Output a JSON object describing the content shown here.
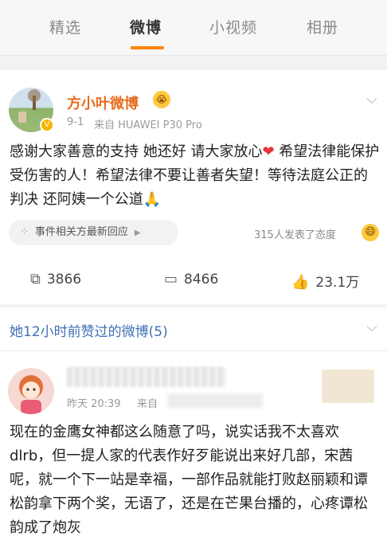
{
  "tabs": [
    "精选",
    "微博",
    "小视频",
    "相册"
  ],
  "post": {
    "author": "方小叶微博",
    "date": "9-1",
    "source": "来自 HUAWEI P30 Pro",
    "text": {
      "part1": "感谢大家善意的支持 她还好 请大家放心",
      "heart": "❤",
      "part2": " 希望法律能保护受伤害的人！希望法律不要让善者失望！等待法庭公正的判决 还阿姨一个公道",
      "hands": "🙏"
    },
    "topic_label": "事件相关方最新回应",
    "reaction_count": "315人发表了态度",
    "reposts": "3866",
    "comments": "8466",
    "likes": "23.1万"
  },
  "liked_section": {
    "title": "她12小时前赞过的微博(5)"
  },
  "post2": {
    "date": "昨天 20:39",
    "source": "来自",
    "text": "现在的金鹰女神都这么随意了吗，说实话我不太喜欢dlrb，但一提人家的代表作好歹能说出来好几部，宋茜呢，就一个下一站是幸福，一部作品就能打败赵丽颖和谭松韵拿下两个奖，无语了，还是在芒果台播的，心疼谭松韵成了炮灰"
  },
  "icons": {
    "verified": "verified-badge-icon",
    "emoji": "emoji-icon",
    "chevron": "chevron-down-icon",
    "repost": "repost-icon",
    "comment": "comment-icon",
    "like": "like-icon"
  },
  "colors": {
    "accent": "#ff8200",
    "name": "#e86c1f",
    "link": "#3f6fb4"
  }
}
